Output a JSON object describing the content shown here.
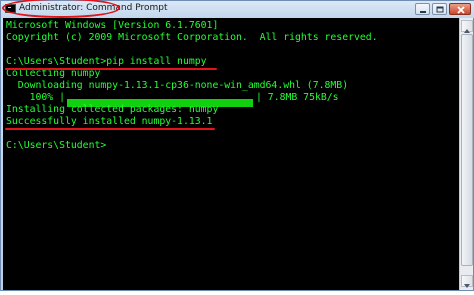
{
  "window": {
    "title": "Administrator: Command Prompt",
    "icon": "cmd-icon",
    "controls": [
      "minimize-icon",
      "maximize-icon",
      "close-icon"
    ]
  },
  "console": {
    "lines": [
      "Microsoft Windows [Version 6.1.7601]",
      "Copyright (c) 2009 Microsoft Corporation.  All rights reserved.",
      "",
      "C:\\Users\\Student>pip install numpy",
      "Collecting numpy",
      "  Downloading numpy-1.13.1-cp36-none-win_amd64.whl (7.8MB)",
      "    100% |",
      "Installing collected packages: numpy",
      "Successfully installed numpy-1.13.1",
      "",
      "C:\\Users\\Student>"
    ],
    "progress": {
      "percent": 100,
      "suffix": "| 7.8MB 75kB/s"
    }
  },
  "colors": {
    "console_text": "#22ff33",
    "console_background": "#000000",
    "annotation": "#e0141a"
  }
}
